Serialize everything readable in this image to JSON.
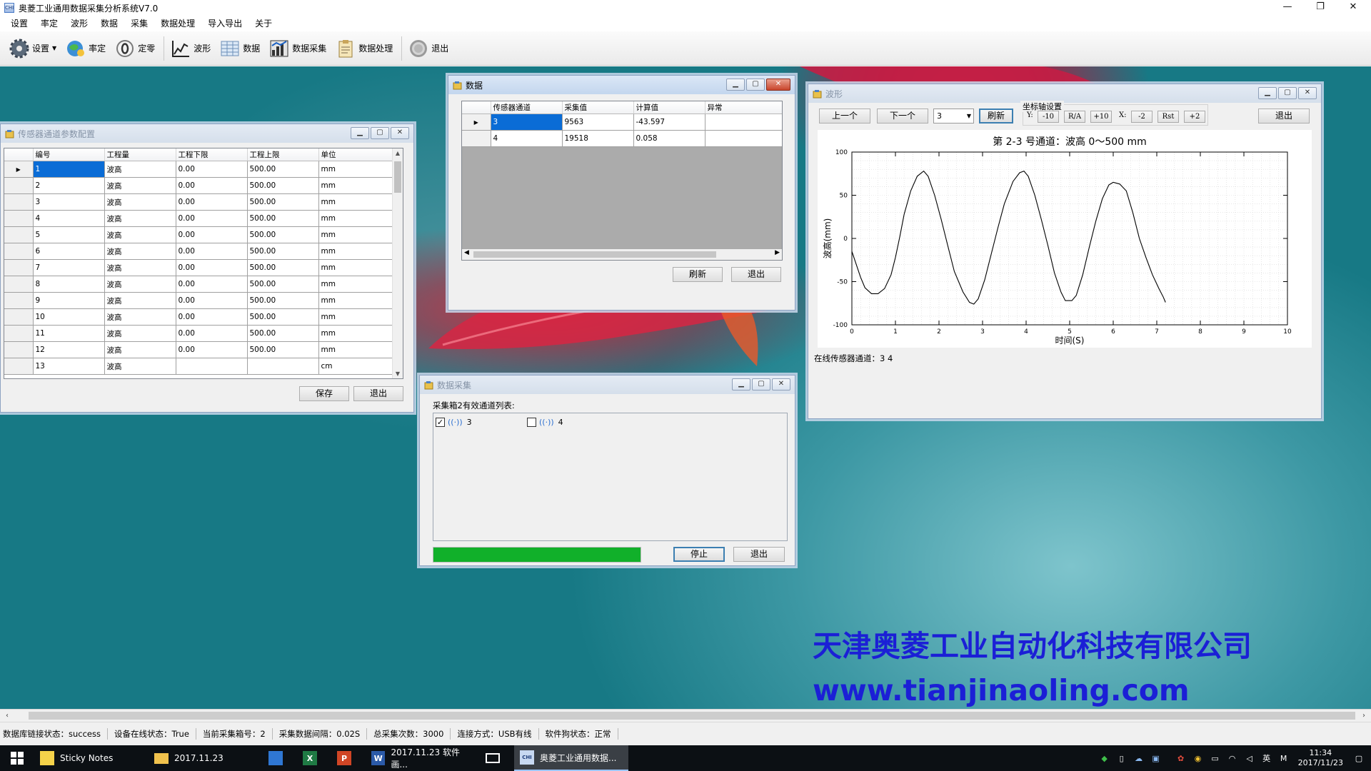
{
  "app": {
    "title": "奥菱工业通用数据采集分析系统V7.0",
    "icon_text": "CHI"
  },
  "window_controls": {
    "minimize": "—",
    "restore": "❐",
    "close": "✕"
  },
  "menu": [
    "设置",
    "率定",
    "波形",
    "数据",
    "采集",
    "数据处理",
    "导入导出",
    "关于"
  ],
  "toolbar": {
    "settings": "设置",
    "calibrate": "率定",
    "zero": "定零",
    "wave": "波形",
    "data": "数据",
    "acquire": "数据采集",
    "process": "数据处理",
    "exit": "退出"
  },
  "sensor_window": {
    "title": "传感器通道参数配置",
    "columns": [
      "编号",
      "工程量",
      "工程下限",
      "工程上限",
      "单位"
    ],
    "rows": [
      [
        "1",
        "波高",
        "0.00",
        "500.00",
        "mm"
      ],
      [
        "2",
        "波高",
        "0.00",
        "500.00",
        "mm"
      ],
      [
        "3",
        "波高",
        "0.00",
        "500.00",
        "mm"
      ],
      [
        "4",
        "波高",
        "0.00",
        "500.00",
        "mm"
      ],
      [
        "5",
        "波高",
        "0.00",
        "500.00",
        "mm"
      ],
      [
        "6",
        "波高",
        "0.00",
        "500.00",
        "mm"
      ],
      [
        "7",
        "波高",
        "0.00",
        "500.00",
        "mm"
      ],
      [
        "8",
        "波高",
        "0.00",
        "500.00",
        "mm"
      ],
      [
        "9",
        "波高",
        "0.00",
        "500.00",
        "mm"
      ],
      [
        "10",
        "波高",
        "0.00",
        "500.00",
        "mm"
      ],
      [
        "11",
        "波高",
        "0.00",
        "500.00",
        "mm"
      ],
      [
        "12",
        "波高",
        "0.00",
        "500.00",
        "mm"
      ],
      [
        "13",
        "波高",
        "",
        "",
        "cm"
      ]
    ],
    "save": "保存",
    "exit": "退出"
  },
  "data_window": {
    "title": "数据",
    "columns": [
      "传感器通道",
      "采集值",
      "计算值",
      "异常"
    ],
    "rows": [
      [
        "3",
        "9563",
        "-43.597",
        ""
      ],
      [
        "4",
        "19518",
        "0.058",
        ""
      ]
    ],
    "refresh": "刷新",
    "exit": "退出"
  },
  "acq_window": {
    "title": "数据采集",
    "list_label": "采集箱2有效通道列表:",
    "channels": [
      {
        "label": "3",
        "checked": true
      },
      {
        "label": "4",
        "checked": false
      }
    ],
    "progress": 1.0,
    "stop": "停止",
    "exit": "退出"
  },
  "wave_window": {
    "title": "波形",
    "prev": "上一个",
    "next": "下一个",
    "channel_select": "3",
    "refresh": "刷新",
    "axis_group": "坐标轴设置",
    "y_label": "Y:",
    "x_label": "X:",
    "y_buttons": [
      "-10",
      "R/A",
      "+10"
    ],
    "x_buttons": [
      "-2",
      "Rst",
      "+2"
    ],
    "exit": "退出",
    "online_label": "在线传感器通道：",
    "online_value": "3 4"
  },
  "chart_data": {
    "type": "line",
    "title": "第 2-3 号通道：波高 0～500 mm",
    "xlabel": "时间(S)",
    "ylabel": "波高(mm)",
    "xlim": [
      0,
      10
    ],
    "ylim": [
      -100,
      100
    ],
    "xticks": [
      0,
      1,
      2,
      3,
      4,
      5,
      6,
      7,
      8,
      9,
      10
    ],
    "yticks": [
      -100,
      -50,
      0,
      50,
      100
    ],
    "grid": true,
    "series": [
      {
        "values": [
          [
            0.0,
            -15
          ],
          [
            0.1,
            -30
          ],
          [
            0.2,
            -45
          ],
          [
            0.3,
            -57
          ],
          [
            0.45,
            -64
          ],
          [
            0.6,
            -64
          ],
          [
            0.75,
            -58
          ],
          [
            0.9,
            -42
          ],
          [
            1.0,
            -22
          ],
          [
            1.1,
            2
          ],
          [
            1.2,
            28
          ],
          [
            1.35,
            55
          ],
          [
            1.5,
            72
          ],
          [
            1.65,
            78
          ],
          [
            1.75,
            72
          ],
          [
            1.9,
            50
          ],
          [
            2.05,
            22
          ],
          [
            2.2,
            -8
          ],
          [
            2.35,
            -38
          ],
          [
            2.55,
            -62
          ],
          [
            2.7,
            -74
          ],
          [
            2.8,
            -76
          ],
          [
            2.9,
            -70
          ],
          [
            3.05,
            -48
          ],
          [
            3.2,
            -18
          ],
          [
            3.35,
            12
          ],
          [
            3.5,
            40
          ],
          [
            3.7,
            66
          ],
          [
            3.85,
            76
          ],
          [
            3.95,
            78
          ],
          [
            4.05,
            72
          ],
          [
            4.2,
            50
          ],
          [
            4.35,
            22
          ],
          [
            4.5,
            -8
          ],
          [
            4.65,
            -40
          ],
          [
            4.8,
            -62
          ],
          [
            4.9,
            -72
          ],
          [
            5.05,
            -72
          ],
          [
            5.15,
            -66
          ],
          [
            5.3,
            -42
          ],
          [
            5.45,
            -10
          ],
          [
            5.6,
            20
          ],
          [
            5.75,
            46
          ],
          [
            5.9,
            62
          ],
          [
            6.0,
            65
          ],
          [
            6.15,
            63
          ],
          [
            6.3,
            55
          ],
          [
            6.45,
            30
          ],
          [
            6.6,
            0
          ],
          [
            6.75,
            -22
          ],
          [
            6.9,
            -42
          ],
          [
            7.05,
            -58
          ],
          [
            7.15,
            -68
          ],
          [
            7.2,
            -74
          ]
        ]
      }
    ]
  },
  "company": {
    "name": "天津奥菱工业自动化科技有限公司",
    "website": "www.tianjinaoling.com"
  },
  "status": [
    "数据库链接状态：success",
    "设备在线状态：True",
    "当前采集箱号：2",
    "采集数据间隔：0.02S",
    "总采集次数：3000",
    "连接方式：USB有线",
    "软件狗状态：正常"
  ],
  "taskbar": {
    "items": [
      {
        "label": "Sticky Notes",
        "icon": "sticky-notes-icon"
      },
      {
        "label": "2017.11.23",
        "icon": "folder-icon"
      },
      {
        "label": "",
        "icon": "store-icon"
      },
      {
        "label": "",
        "icon": "excel-icon"
      },
      {
        "label": "",
        "icon": "powerpoint-icon"
      },
      {
        "label": "2017.11.23 软件画...",
        "icon": "word-icon"
      },
      {
        "label": "",
        "icon": "mail-icon"
      },
      {
        "label": "奥菱工业通用数据...",
        "icon": "app-icon"
      }
    ],
    "time": "11:34",
    "date": "2017/11/23",
    "ime": "英",
    "ime2": "M"
  },
  "colors": {
    "progress": "#11b02a",
    "selection": "#0a6cd6",
    "company_text": "#1b1fd6"
  }
}
